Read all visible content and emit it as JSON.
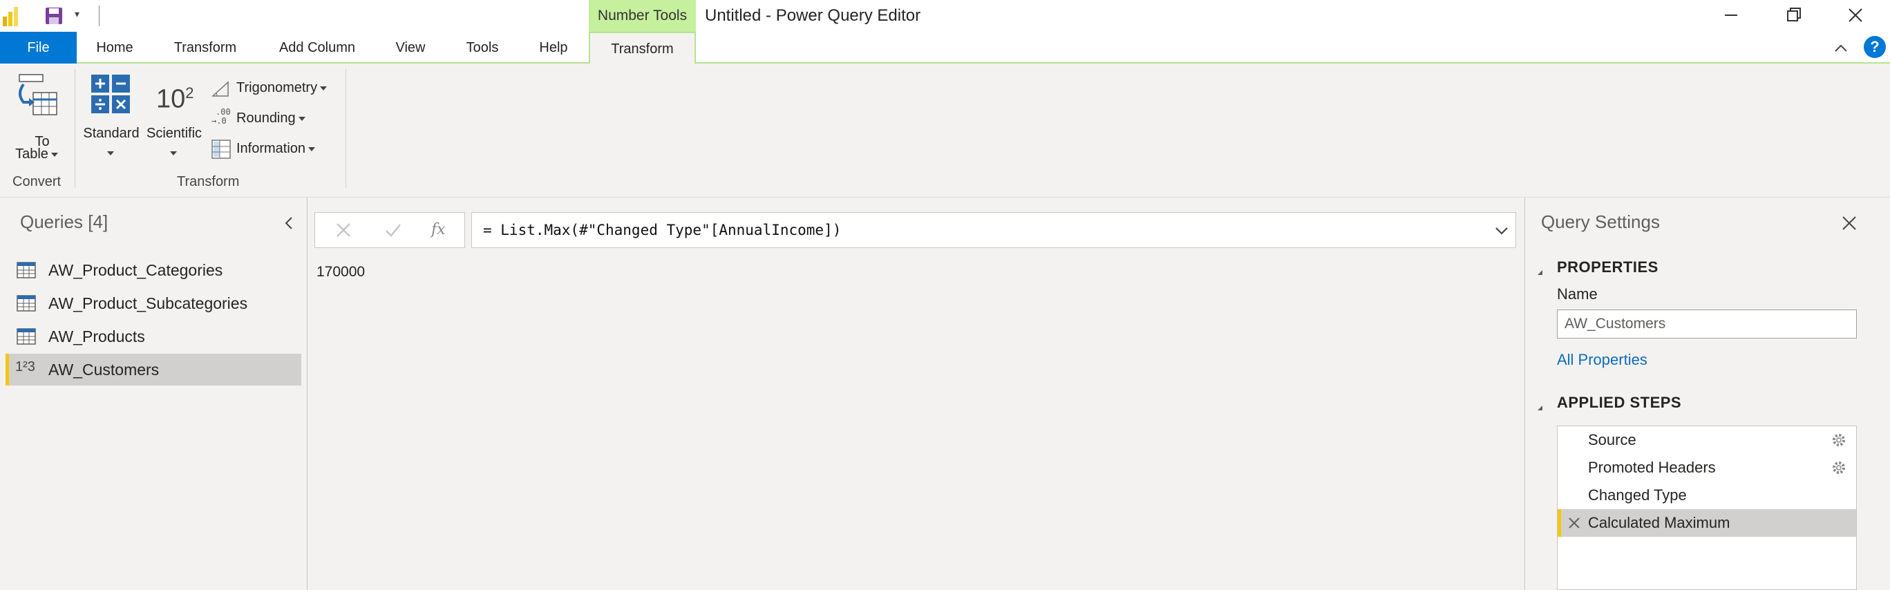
{
  "titlebar": {
    "context_tab_group": "Number Tools",
    "window_title": "Untitled - Power Query Editor"
  },
  "tabs": [
    {
      "label": "File"
    },
    {
      "label": "Home"
    },
    {
      "label": "Transform"
    },
    {
      "label": "Add Column"
    },
    {
      "label": "View"
    },
    {
      "label": "Tools"
    },
    {
      "label": "Help"
    },
    {
      "label": "Transform"
    }
  ],
  "help_label": "?",
  "ribbon": {
    "convert": {
      "to_table_line1": "To",
      "to_table_line2": "Table",
      "group_label": "Convert"
    },
    "transform": {
      "standard": "Standard",
      "scientific": "Scientific",
      "scientific_glyph_base": "10",
      "scientific_glyph_exp": "2",
      "trigonometry": "Trigonometry",
      "rounding": "Rounding",
      "rounding_glyph_top": ".00",
      "rounding_glyph_bottom": "→.0",
      "information": "Information",
      "group_label": "Transform"
    }
  },
  "queries": {
    "title": "Queries [4]",
    "items": [
      {
        "label": "AW_Product_Categories",
        "icon": "table-icon"
      },
      {
        "label": "AW_Product_Subcategories",
        "icon": "table-icon"
      },
      {
        "label": "AW_Products",
        "icon": "table-icon"
      },
      {
        "label": "AW_Customers",
        "icon": "number-type-icon",
        "selected": true
      }
    ],
    "number_icon_glyph": "1²3"
  },
  "formula": {
    "fx": "fx",
    "text": "= List.Max(#\"Changed Type\"[AnnualIncome])"
  },
  "result": {
    "value": "170000"
  },
  "settings": {
    "title": "Query Settings",
    "properties_header": "PROPERTIES",
    "name_label": "Name",
    "name_value": "AW_Customers",
    "all_properties": "All Properties",
    "applied_steps_header": "APPLIED STEPS",
    "steps": [
      {
        "label": "Source",
        "has_gear": true
      },
      {
        "label": "Promoted Headers",
        "has_gear": true
      },
      {
        "label": "Changed Type",
        "has_gear": false
      },
      {
        "label": "Calculated Maximum",
        "has_gear": false,
        "selected": true
      }
    ]
  },
  "colors": {
    "accent_blue": "#0078d4",
    "context_green": "#c6ef9e",
    "selection_yellow": "#f2c811"
  }
}
